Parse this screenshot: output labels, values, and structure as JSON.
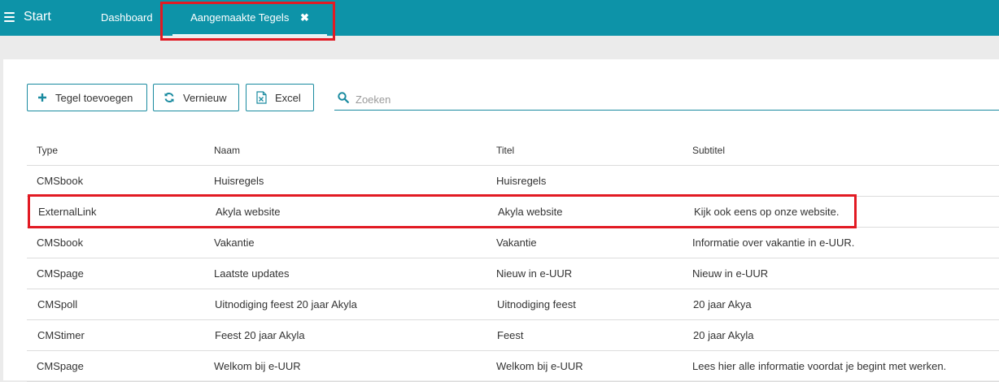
{
  "header": {
    "start_label": "Start",
    "tabs": [
      {
        "label": "Dashboard",
        "active": false
      },
      {
        "label": "Aangemaakte Tegels",
        "active": true,
        "closable": true
      }
    ],
    "close_icon": "✖",
    "color": "#0d93a8"
  },
  "toolbar": {
    "add_label": "Tegel toevoegen",
    "refresh_label": "Vernieuw",
    "excel_label": "Excel",
    "search_placeholder": "Zoeken"
  },
  "table": {
    "columns": [
      "Type",
      "Naam",
      "Titel",
      "Subtitel"
    ],
    "rows": [
      {
        "type": "CMSbook",
        "naam": "Huisregels",
        "titel": "Huisregels",
        "subtitel": ""
      },
      {
        "type": "ExternalLink",
        "naam": "Akyla website",
        "titel": "Akyla website",
        "subtitel": "Kijk ook eens op onze website."
      },
      {
        "type": "CMSbook",
        "naam": "Vakantie",
        "titel": "Vakantie",
        "subtitel": "Informatie over vakantie in e-UUR."
      },
      {
        "type": "CMSpage",
        "naam": "Laatste updates",
        "titel": "Nieuw in e-UUR",
        "subtitel": "Nieuw in e-UUR"
      },
      {
        "type": "CMSpoll",
        "naam": "Uitnodiging feest 20 jaar Akyla",
        "titel": "Uitnodiging feest",
        "subtitel": "20 jaar Akya"
      },
      {
        "type": "CMStimer",
        "naam": "Feest 20 jaar Akyla",
        "titel": "Feest",
        "subtitel": "20 jaar Akyla"
      },
      {
        "type": "CMSpage",
        "naam": "Welkom bij e-UUR",
        "titel": "Welkom bij e-UUR",
        "subtitel": "Lees hier alle informatie voordat je begint met werken."
      }
    ]
  },
  "colors": {
    "accent": "#0d93a8",
    "annotation": "#e21a23"
  },
  "icons": {
    "menu": "hamburger-icon",
    "add": "plus-icon",
    "refresh": "refresh-icon",
    "excel": "excel-file-icon",
    "search": "search-icon",
    "close": "close-icon"
  }
}
